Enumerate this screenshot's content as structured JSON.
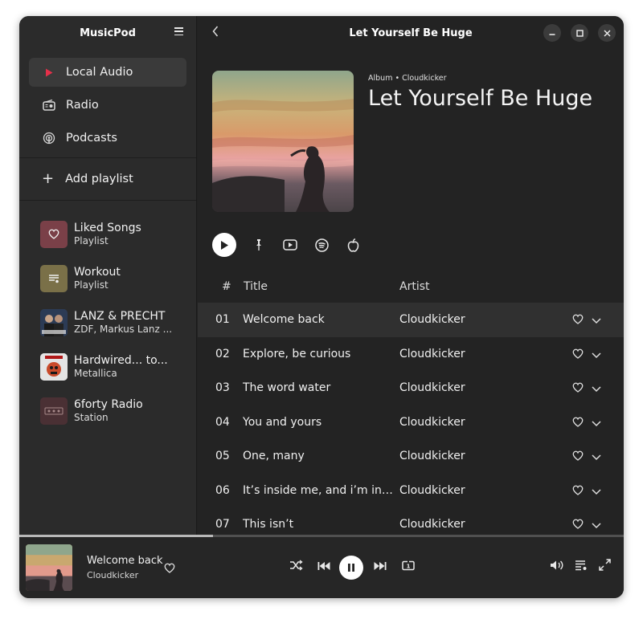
{
  "sidebar": {
    "app_title": "MusicPod",
    "nav": [
      {
        "label": "Local Audio",
        "icon": "play-icon"
      },
      {
        "label": "Radio",
        "icon": "radio-icon"
      },
      {
        "label": "Podcasts",
        "icon": "podcast-icon"
      }
    ],
    "add_playlist": "Add playlist",
    "playlists": [
      {
        "title": "Liked Songs",
        "subtitle": "Playlist",
        "color": "#7a4048"
      },
      {
        "title": "Workout",
        "subtitle": "Playlist",
        "color": "#7a7048"
      },
      {
        "title": "LANZ & PRECHT",
        "subtitle": "ZDF, Markus Lanz ...",
        "color": "#2c3b55"
      },
      {
        "title": "Hardwired... to...",
        "subtitle": "Metallica",
        "color": "#d8d8d8"
      },
      {
        "title": "6forty Radio",
        "subtitle": "Station",
        "color": "#4a3034"
      }
    ]
  },
  "main": {
    "header_title": "Let Yourself Be Huge",
    "album_kind": "Album • Cloudkicker",
    "album_title": "Let Yourself Be Huge",
    "columns": {
      "num": "#",
      "title": "Title",
      "artist": "Artist"
    },
    "tracks": [
      {
        "num": "01",
        "title": "Welcome back",
        "artist": "Cloudkicker",
        "active": true
      },
      {
        "num": "02",
        "title": "Explore, be curious",
        "artist": "Cloudkicker",
        "active": false
      },
      {
        "num": "03",
        "title": "The word water",
        "artist": "Cloudkicker",
        "active": false
      },
      {
        "num": "04",
        "title": "You and yours",
        "artist": "Cloudkicker",
        "active": false
      },
      {
        "num": "05",
        "title": "One, many",
        "artist": "Cloudkicker",
        "active": false
      },
      {
        "num": "06",
        "title": "It’s inside me, and i’m inside it",
        "artist": "Cloudkicker",
        "active": false
      },
      {
        "num": "07",
        "title": "This isn’t",
        "artist": "Cloudkicker",
        "active": false
      }
    ]
  },
  "player": {
    "title": "Welcome back",
    "artist": "Cloudkicker",
    "progress": 0.32
  },
  "colors": {
    "accent": "#e5304a",
    "background": "#222222"
  }
}
